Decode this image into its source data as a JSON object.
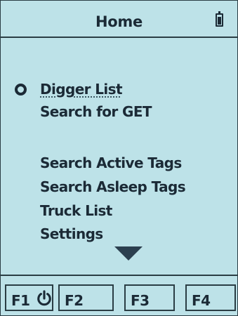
{
  "header": {
    "title": "Home",
    "battery_icon": "battery-icon"
  },
  "menu": {
    "items": [
      {
        "label": "Digger List",
        "selected": true
      },
      {
        "label": "Search for GET"
      },
      {
        "label": "Search Active Tags"
      },
      {
        "label": "Search Asleep Tags"
      },
      {
        "label": "Truck List"
      },
      {
        "label": "Settings"
      }
    ],
    "scroll_icon": "triangle-down-icon",
    "selection_icon": "radio-selected-icon"
  },
  "function_keys": [
    {
      "label": "F1",
      "icon": "power-icon"
    },
    {
      "label": "F2"
    },
    {
      "label": "F3"
    },
    {
      "label": "F4"
    }
  ],
  "colors": {
    "background": "#bde2e8",
    "foreground": "#1b2a36"
  }
}
